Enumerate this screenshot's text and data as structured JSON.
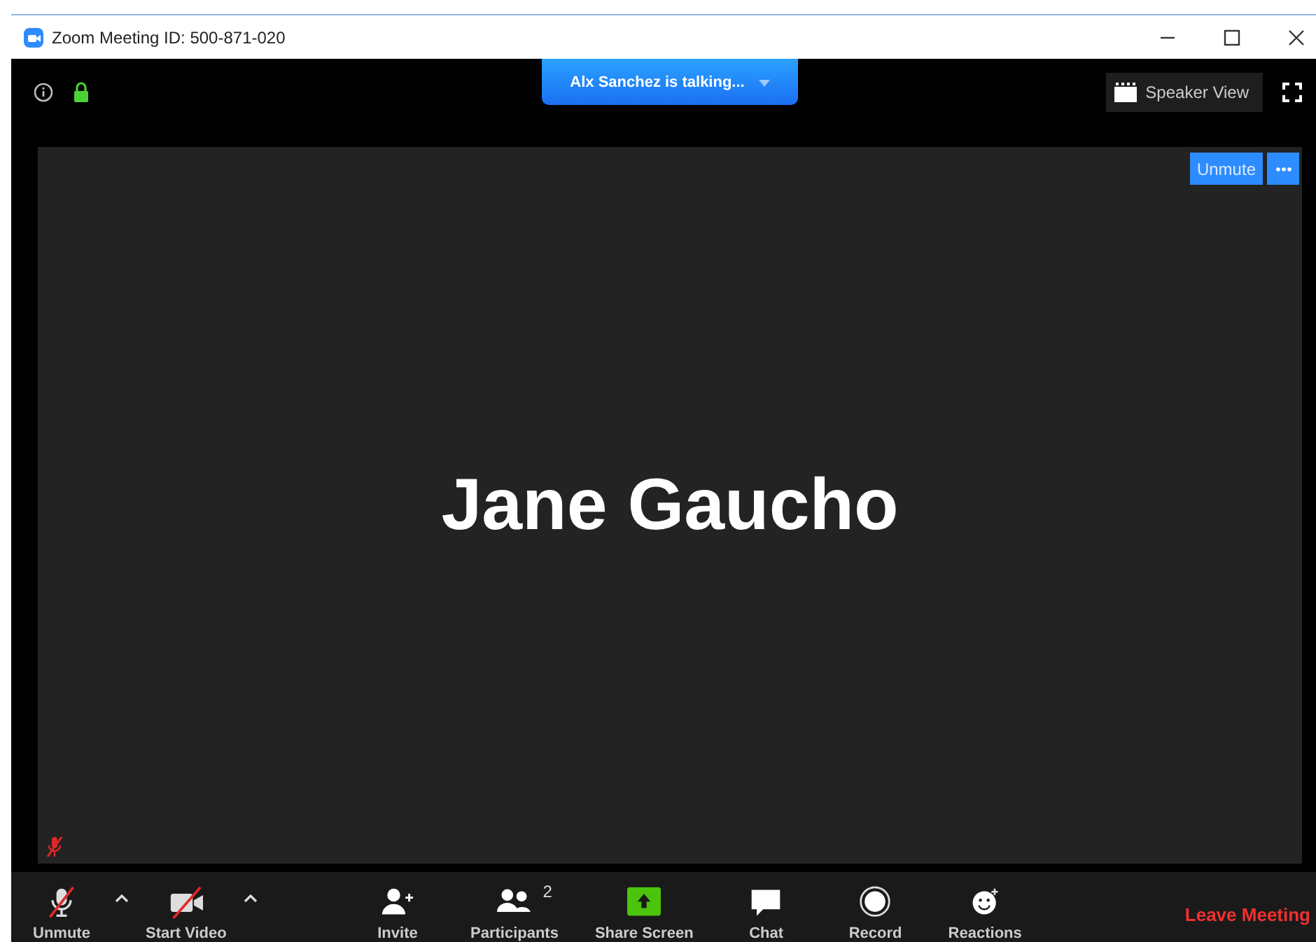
{
  "window": {
    "title": "Zoom Meeting ID: 500-871-020"
  },
  "talking_banner": "Alx Sanchez is talking...",
  "speaker_view_button": "Speaker View",
  "video_tile": {
    "name": "Jane Gaucho",
    "muted": true,
    "unmute_button": "Unmute"
  },
  "toolbar": [
    {
      "kind": "mic",
      "label": "Unmute",
      "muted": true,
      "caret": true
    },
    {
      "kind": "video",
      "label": "Start Video",
      "muted": true,
      "caret": true
    },
    {
      "kind": "invite",
      "label": "Invite"
    },
    {
      "kind": "participants",
      "label": "Participants",
      "count": "2"
    },
    {
      "kind": "share",
      "label": "Share Screen"
    },
    {
      "kind": "chat",
      "label": "Chat"
    },
    {
      "kind": "record",
      "label": "Record"
    },
    {
      "kind": "reactions",
      "label": "Reactions"
    }
  ],
  "leave_button": "Leave Meeting"
}
